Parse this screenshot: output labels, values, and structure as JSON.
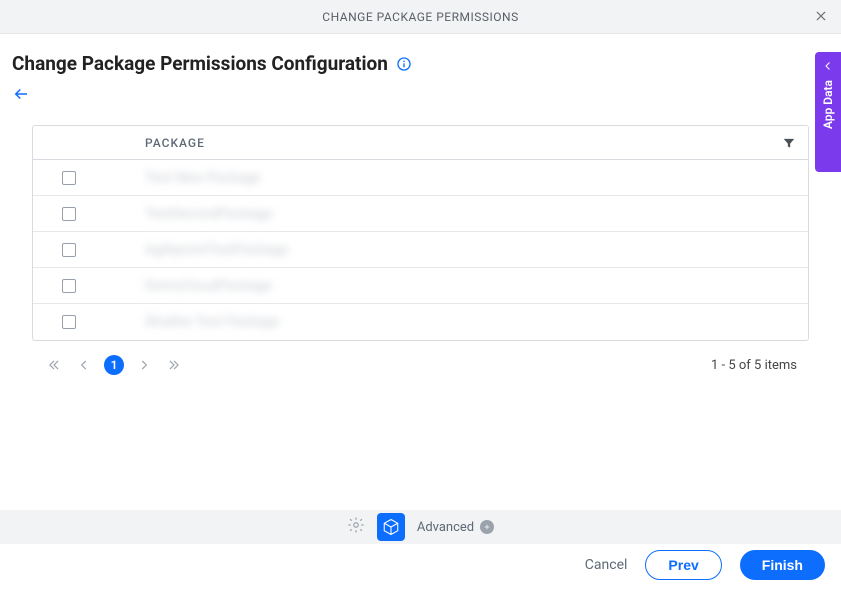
{
  "header": {
    "title": "CHANGE PACKAGE PERMISSIONS"
  },
  "page": {
    "title": "Change Package Permissions Configuration"
  },
  "table": {
    "column_label": "PACKAGE",
    "rows": [
      {
        "name": "Test New Package"
      },
      {
        "name": "TestSecondPackage"
      },
      {
        "name": "AgilepointTestPackage"
      },
      {
        "name": "DemoCloudPackage"
      },
      {
        "name": "Shubha Test Package"
      }
    ]
  },
  "pagination": {
    "current_page": "1",
    "summary": "1 - 5 of 5 items"
  },
  "toolbar": {
    "advanced_label": "Advanced"
  },
  "actions": {
    "cancel": "Cancel",
    "prev": "Prev",
    "finish": "Finish"
  },
  "side_panel": {
    "label": "App Data"
  }
}
